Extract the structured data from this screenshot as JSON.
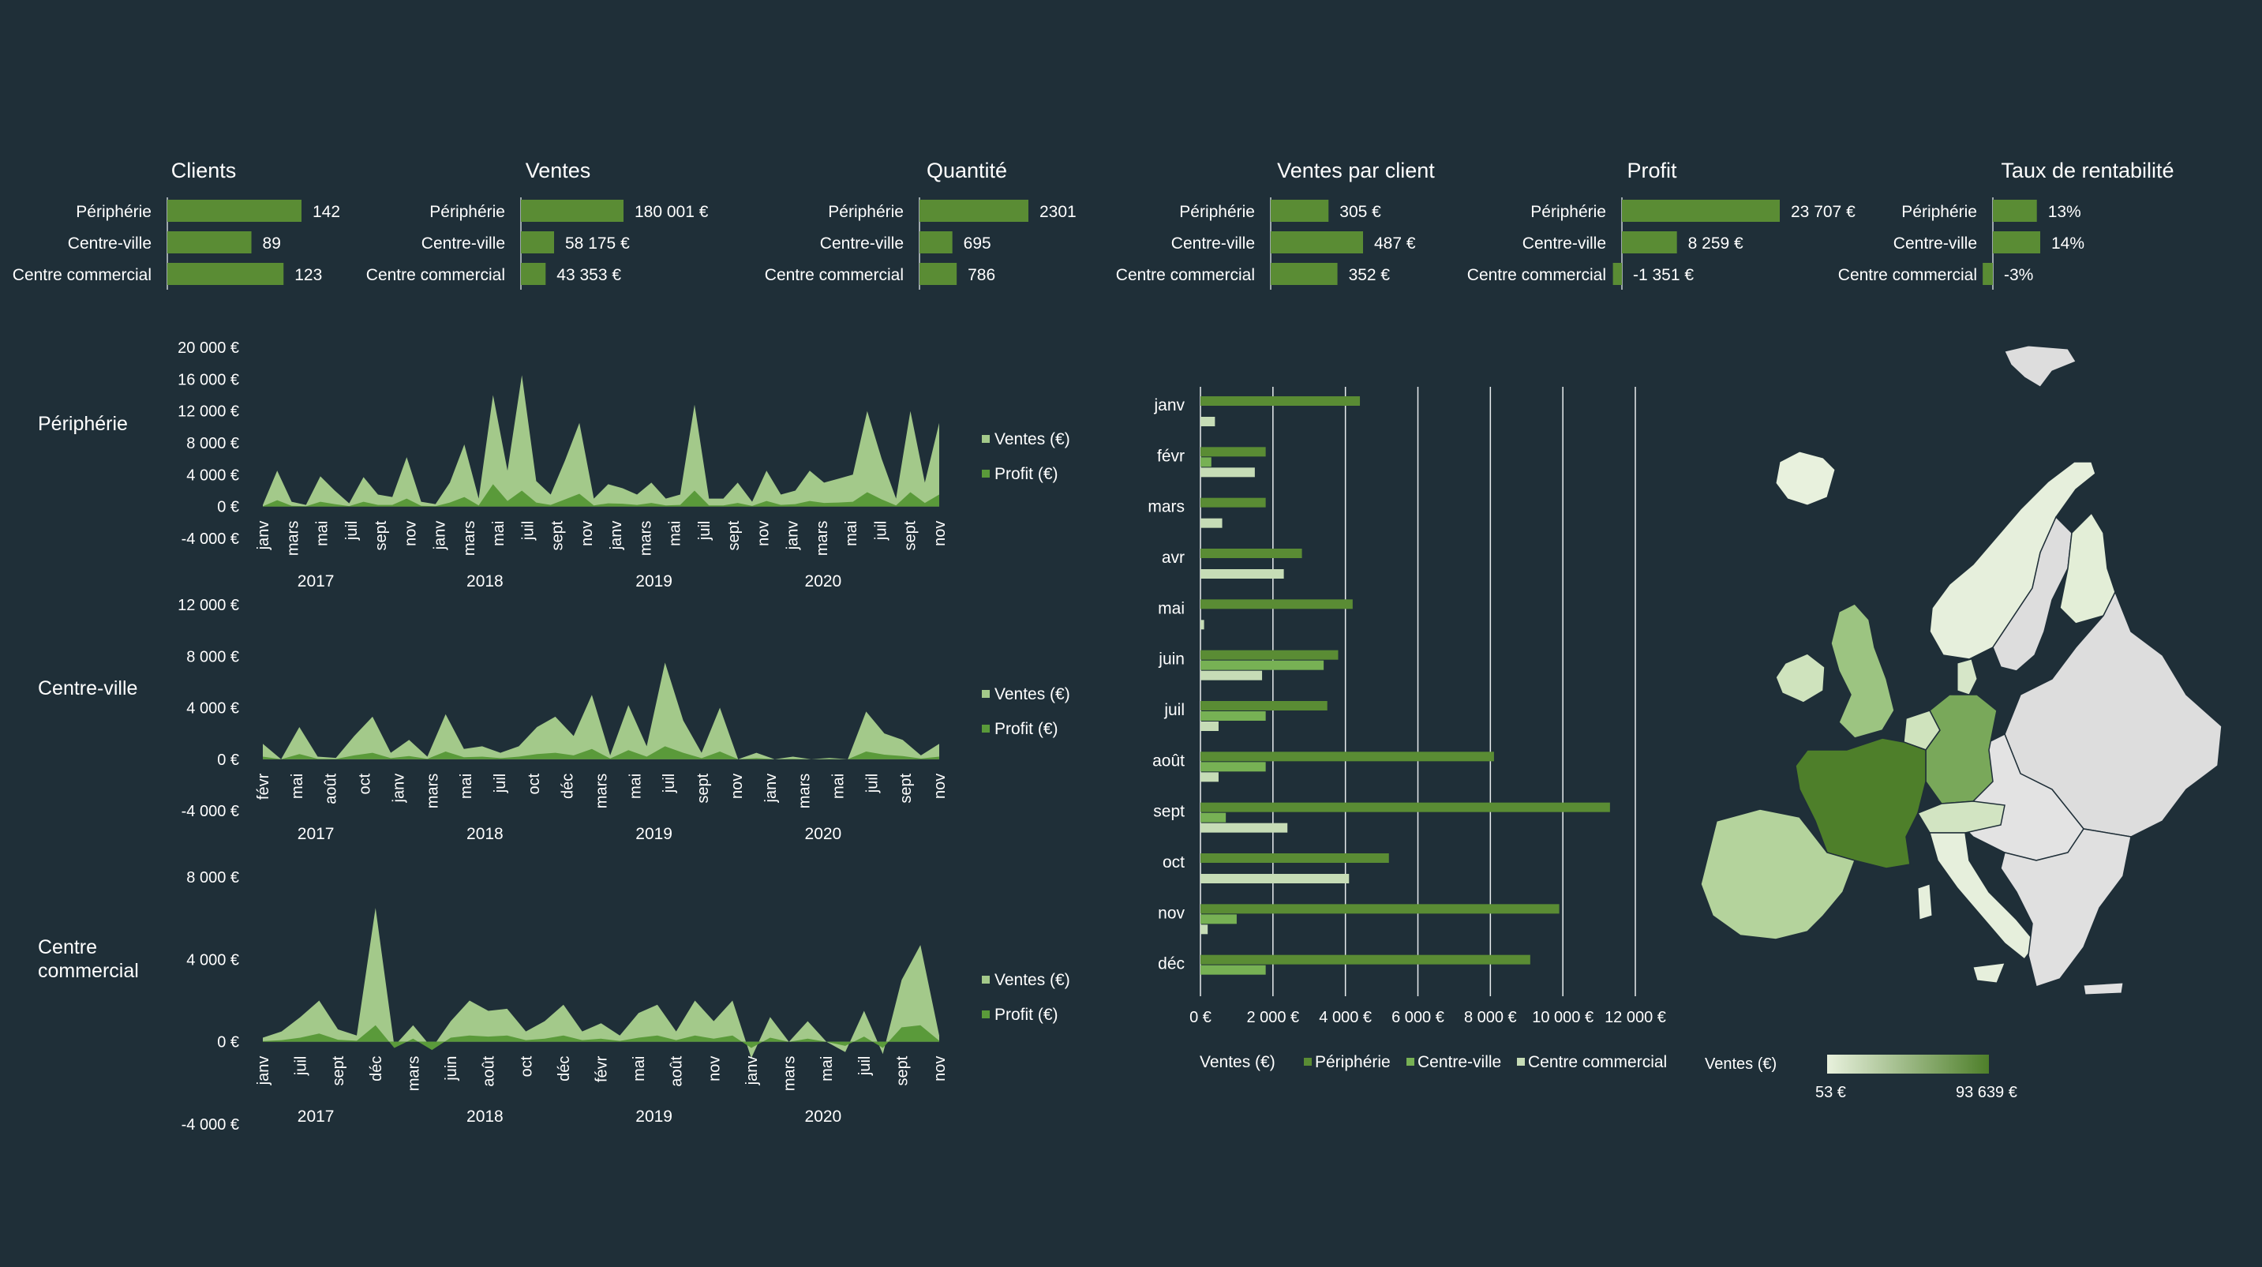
{
  "colors": {
    "background": "#1f2f38",
    "bar": "#5a8c34",
    "ventes_area": "#a3c98a",
    "profit_area": "#5a9a3a",
    "periph": "#5a8c34",
    "centreville": "#77b154",
    "centrecomm": "#c6dcb6",
    "map_low": "#e8f1dd",
    "map_high": "#4e7f2a",
    "map_nodata": "#dddddd"
  },
  "store_types": [
    "Périphérie",
    "Centre-ville",
    "Centre commercial"
  ],
  "kpis": [
    {
      "title": "Clients",
      "values": [
        142,
        89,
        123
      ],
      "labels": [
        "142",
        "89",
        "123"
      ]
    },
    {
      "title": "Ventes",
      "values": [
        180001,
        58175,
        43353
      ],
      "labels": [
        "180 001 €",
        "58 175 €",
        "43 353 €"
      ]
    },
    {
      "title": "Quantité",
      "values": [
        2301,
        695,
        786
      ],
      "labels": [
        "2301",
        "695",
        "786"
      ]
    },
    {
      "title": "Ventes par client",
      "values": [
        305,
        487,
        352
      ],
      "labels": [
        "305 €",
        "487 €",
        "352 €"
      ]
    },
    {
      "title": "Profit",
      "values": [
        23707,
        8259,
        -1351
      ],
      "labels": [
        "23 707 €",
        "8 259 €",
        "-1 351 €"
      ]
    },
    {
      "title": "Taux de rentabilité",
      "values": [
        13,
        14,
        -3
      ],
      "labels": [
        "13%",
        "14%",
        "-3%"
      ]
    }
  ],
  "chart_data": [
    {
      "type": "area",
      "title": "Périphérie",
      "ylim": [
        -4000,
        20000
      ],
      "yticks": [
        -4000,
        0,
        4000,
        8000,
        12000,
        16000,
        20000
      ],
      "ytick_labels": [
        "-4 000 €",
        "0 €",
        "4 000 €",
        "8 000 €",
        "12 000 €",
        "16 000 €",
        "20 000 €"
      ],
      "x_tick_labels": [
        "janv",
        "mars",
        "mai",
        "juil",
        "sept",
        "nov",
        "janv",
        "mars",
        "mai",
        "juil",
        "sept",
        "nov",
        "janv",
        "mars",
        "mai",
        "juil",
        "sept",
        "nov",
        "janv",
        "mars",
        "mai",
        "juil",
        "sept",
        "nov"
      ],
      "years": [
        "2017",
        "2018",
        "2019",
        "2020"
      ],
      "series": [
        {
          "name": "Ventes (€)",
          "values": [
            200,
            4500,
            600,
            200,
            3800,
            2000,
            400,
            3700,
            1500,
            1200,
            6200,
            600,
            300,
            3000,
            7800,
            1000,
            14000,
            4500,
            16500,
            3200,
            1500,
            5800,
            10500,
            1000,
            2800,
            2300,
            1500,
            3000,
            1000,
            1500,
            12800,
            1000,
            1000,
            3000,
            600,
            4500,
            1500,
            2000,
            4500,
            3000,
            3500,
            4000,
            12000,
            6000,
            1000,
            12000,
            3000,
            10500
          ]
        },
        {
          "name": "Profit (€)",
          "values": [
            30,
            800,
            100,
            30,
            600,
            300,
            60,
            600,
            200,
            200,
            1000,
            100,
            40,
            500,
            1200,
            150,
            2800,
            700,
            2000,
            500,
            200,
            900,
            1600,
            150,
            400,
            350,
            200,
            450,
            150,
            200,
            2000,
            150,
            150,
            450,
            80,
            700,
            200,
            300,
            700,
            450,
            500,
            600,
            1800,
            900,
            150,
            1800,
            450,
            1500
          ]
        }
      ]
    },
    {
      "type": "area",
      "title": "Centre-ville",
      "ylim": [
        -4000,
        12000
      ],
      "yticks": [
        -4000,
        0,
        4000,
        8000,
        12000
      ],
      "ytick_labels": [
        "-4 000 €",
        "0 €",
        "4 000 €",
        "8 000 €",
        "12 000 €"
      ],
      "x_tick_labels": [
        "févr",
        "mai",
        "août",
        "oct",
        "janv",
        "mars",
        "mai",
        "juil",
        "oct",
        "déc",
        "mars",
        "mai",
        "juil",
        "sept",
        "nov",
        "janv",
        "mars",
        "mai",
        "juil",
        "sept",
        "nov"
      ],
      "years": [
        "2017",
        "2018",
        "2019",
        "2020"
      ],
      "series": [
        {
          "name": "Ventes (€)",
          "values": [
            1200,
            0,
            2500,
            200,
            100,
            1800,
            3300,
            500,
            1500,
            200,
            3500,
            800,
            1000,
            500,
            1000,
            2500,
            3300,
            1800,
            5000,
            300,
            4200,
            1000,
            7500,
            3000,
            500,
            4000,
            0,
            500,
            0,
            200,
            0,
            100,
            0,
            3700,
            2000,
            1500,
            300,
            1200
          ]
        },
        {
          "name": "Profit (€)",
          "values": [
            200,
            0,
            400,
            30,
            20,
            300,
            500,
            80,
            250,
            30,
            600,
            150,
            200,
            80,
            200,
            400,
            500,
            300,
            800,
            50,
            700,
            200,
            1000,
            500,
            80,
            600,
            0,
            80,
            0,
            30,
            0,
            20,
            0,
            600,
            350,
            250,
            50,
            200
          ]
        }
      ]
    },
    {
      "type": "area",
      "title": "Centre commercial",
      "ylim": [
        -4000,
        8000
      ],
      "yticks": [
        -4000,
        0,
        4000,
        8000
      ],
      "ytick_labels": [
        "-4 000 €",
        "0 €",
        "4 000 €",
        "8 000 €"
      ],
      "x_tick_labels": [
        "janv",
        "juil",
        "sept",
        "déc",
        "mars",
        "juin",
        "août",
        "oct",
        "déc",
        "févr",
        "mai",
        "août",
        "nov",
        "janv",
        "mars",
        "mai",
        "juil",
        "sept",
        "nov"
      ],
      "years": [
        "2017",
        "2018",
        "2019",
        "2020"
      ],
      "series": [
        {
          "name": "Ventes (€)",
          "values": [
            200,
            500,
            1200,
            2000,
            600,
            300,
            6500,
            -200,
            800,
            -300,
            1000,
            2000,
            1500,
            1600,
            500,
            1000,
            1800,
            500,
            900,
            300,
            1400,
            1800,
            500,
            2000,
            1000,
            2000,
            -800,
            1200,
            0,
            1000,
            0,
            -500,
            1500,
            -600,
            3000,
            4700,
            300
          ]
        },
        {
          "name": "Profit (€)",
          "values": [
            30,
            80,
            200,
            400,
            100,
            50,
            800,
            -300,
            150,
            -400,
            200,
            300,
            250,
            300,
            80,
            150,
            300,
            80,
            150,
            40,
            200,
            300,
            80,
            300,
            150,
            300,
            -300,
            200,
            0,
            150,
            0,
            -200,
            250,
            -300,
            700,
            800,
            50
          ]
        }
      ]
    },
    {
      "type": "bar",
      "orientation": "horizontal",
      "categories": [
        "janv",
        "févr",
        "mars",
        "avr",
        "mai",
        "juin",
        "juil",
        "août",
        "sept",
        "oct",
        "nov",
        "déc"
      ],
      "xlim": [
        0,
        12000
      ],
      "xticks": [
        0,
        2000,
        4000,
        6000,
        8000,
        10000,
        12000
      ],
      "xtick_labels": [
        "0 €",
        "2 000 €",
        "4 000 €",
        "6 000 €",
        "8 000 €",
        "10 000 €",
        "12 000 €"
      ],
      "xlabel": "Ventes (€)",
      "series": [
        {
          "name": "Périphérie",
          "values": [
            4400,
            1800,
            1800,
            2800,
            4200,
            3800,
            3500,
            8100,
            11300,
            5200,
            9900,
            9100
          ]
        },
        {
          "name": "Centre-ville",
          "values": [
            0,
            300,
            0,
            0,
            0,
            3400,
            1800,
            1800,
            700,
            0,
            1000,
            1800
          ]
        },
        {
          "name": "Centre commercial",
          "values": [
            400,
            1500,
            600,
            2300,
            100,
            1700,
            500,
            500,
            2400,
            4100,
            200,
            0
          ]
        }
      ]
    }
  ],
  "map": {
    "legend_title": "Ventes (€)",
    "min_label": "53 €",
    "max_label": "93 639 €",
    "regions": [
      {
        "name": "France",
        "value": 93639
      },
      {
        "name": "Allemagne",
        "value": 55000
      },
      {
        "name": "Espagne",
        "value": 20000
      },
      {
        "name": "Royaume-Uni",
        "value": 25000
      },
      {
        "name": "Irlande",
        "value": 8000
      },
      {
        "name": "Italie",
        "value": 6000
      },
      {
        "name": "Suède",
        "value": 2000
      },
      {
        "name": "Norvège",
        "value": 3000
      },
      {
        "name": "Finlande",
        "value": 4000
      },
      {
        "name": "Islande",
        "value": 53
      }
    ]
  }
}
